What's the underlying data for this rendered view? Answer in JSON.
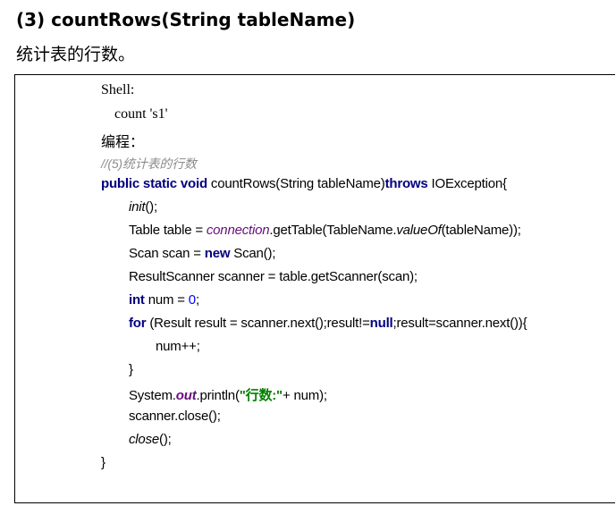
{
  "heading": "(3) countRows(String tableName)",
  "intro": "统计表的行数。",
  "shell": {
    "label": "Shell:",
    "command": "count 's1'"
  },
  "programming_label": "编程：",
  "code": {
    "comment": "//(5)统计表的行数",
    "sig_kw": "public static void",
    "sig_mid": " countRows(String tableName)",
    "sig_throws": "throws",
    "sig_end": " IOException{",
    "init": "init",
    "init_end": "();",
    "table_start": "Table table = ",
    "connection": "connection",
    "get_table": ".getTable(TableName.",
    "value_of": "valueOf",
    "table_end": "(tableName));",
    "scan_start": "Scan scan = ",
    "new_kw": "new",
    "scan_end": " Scan();",
    "scanner_line": "ResultScanner scanner = table.getScanner(scan);",
    "int_kw": "int",
    "num_mid": " num = ",
    "zero": "0",
    "semicolon": ";",
    "for_kw": "for",
    "for_mid": " (Result result = scanner.next();result!=",
    "null_kw": "null",
    "for_end": ";result=scanner.next()){",
    "inc": "num++;",
    "close_brace": "}",
    "sys": "System.",
    "out": "out",
    "println": ".println(",
    "str": "\"行数:\"",
    "println_end": "+ num);",
    "scanner_close": "scanner.close();",
    "close_fn": "close",
    "close_end": "();",
    "final_brace": "}"
  }
}
